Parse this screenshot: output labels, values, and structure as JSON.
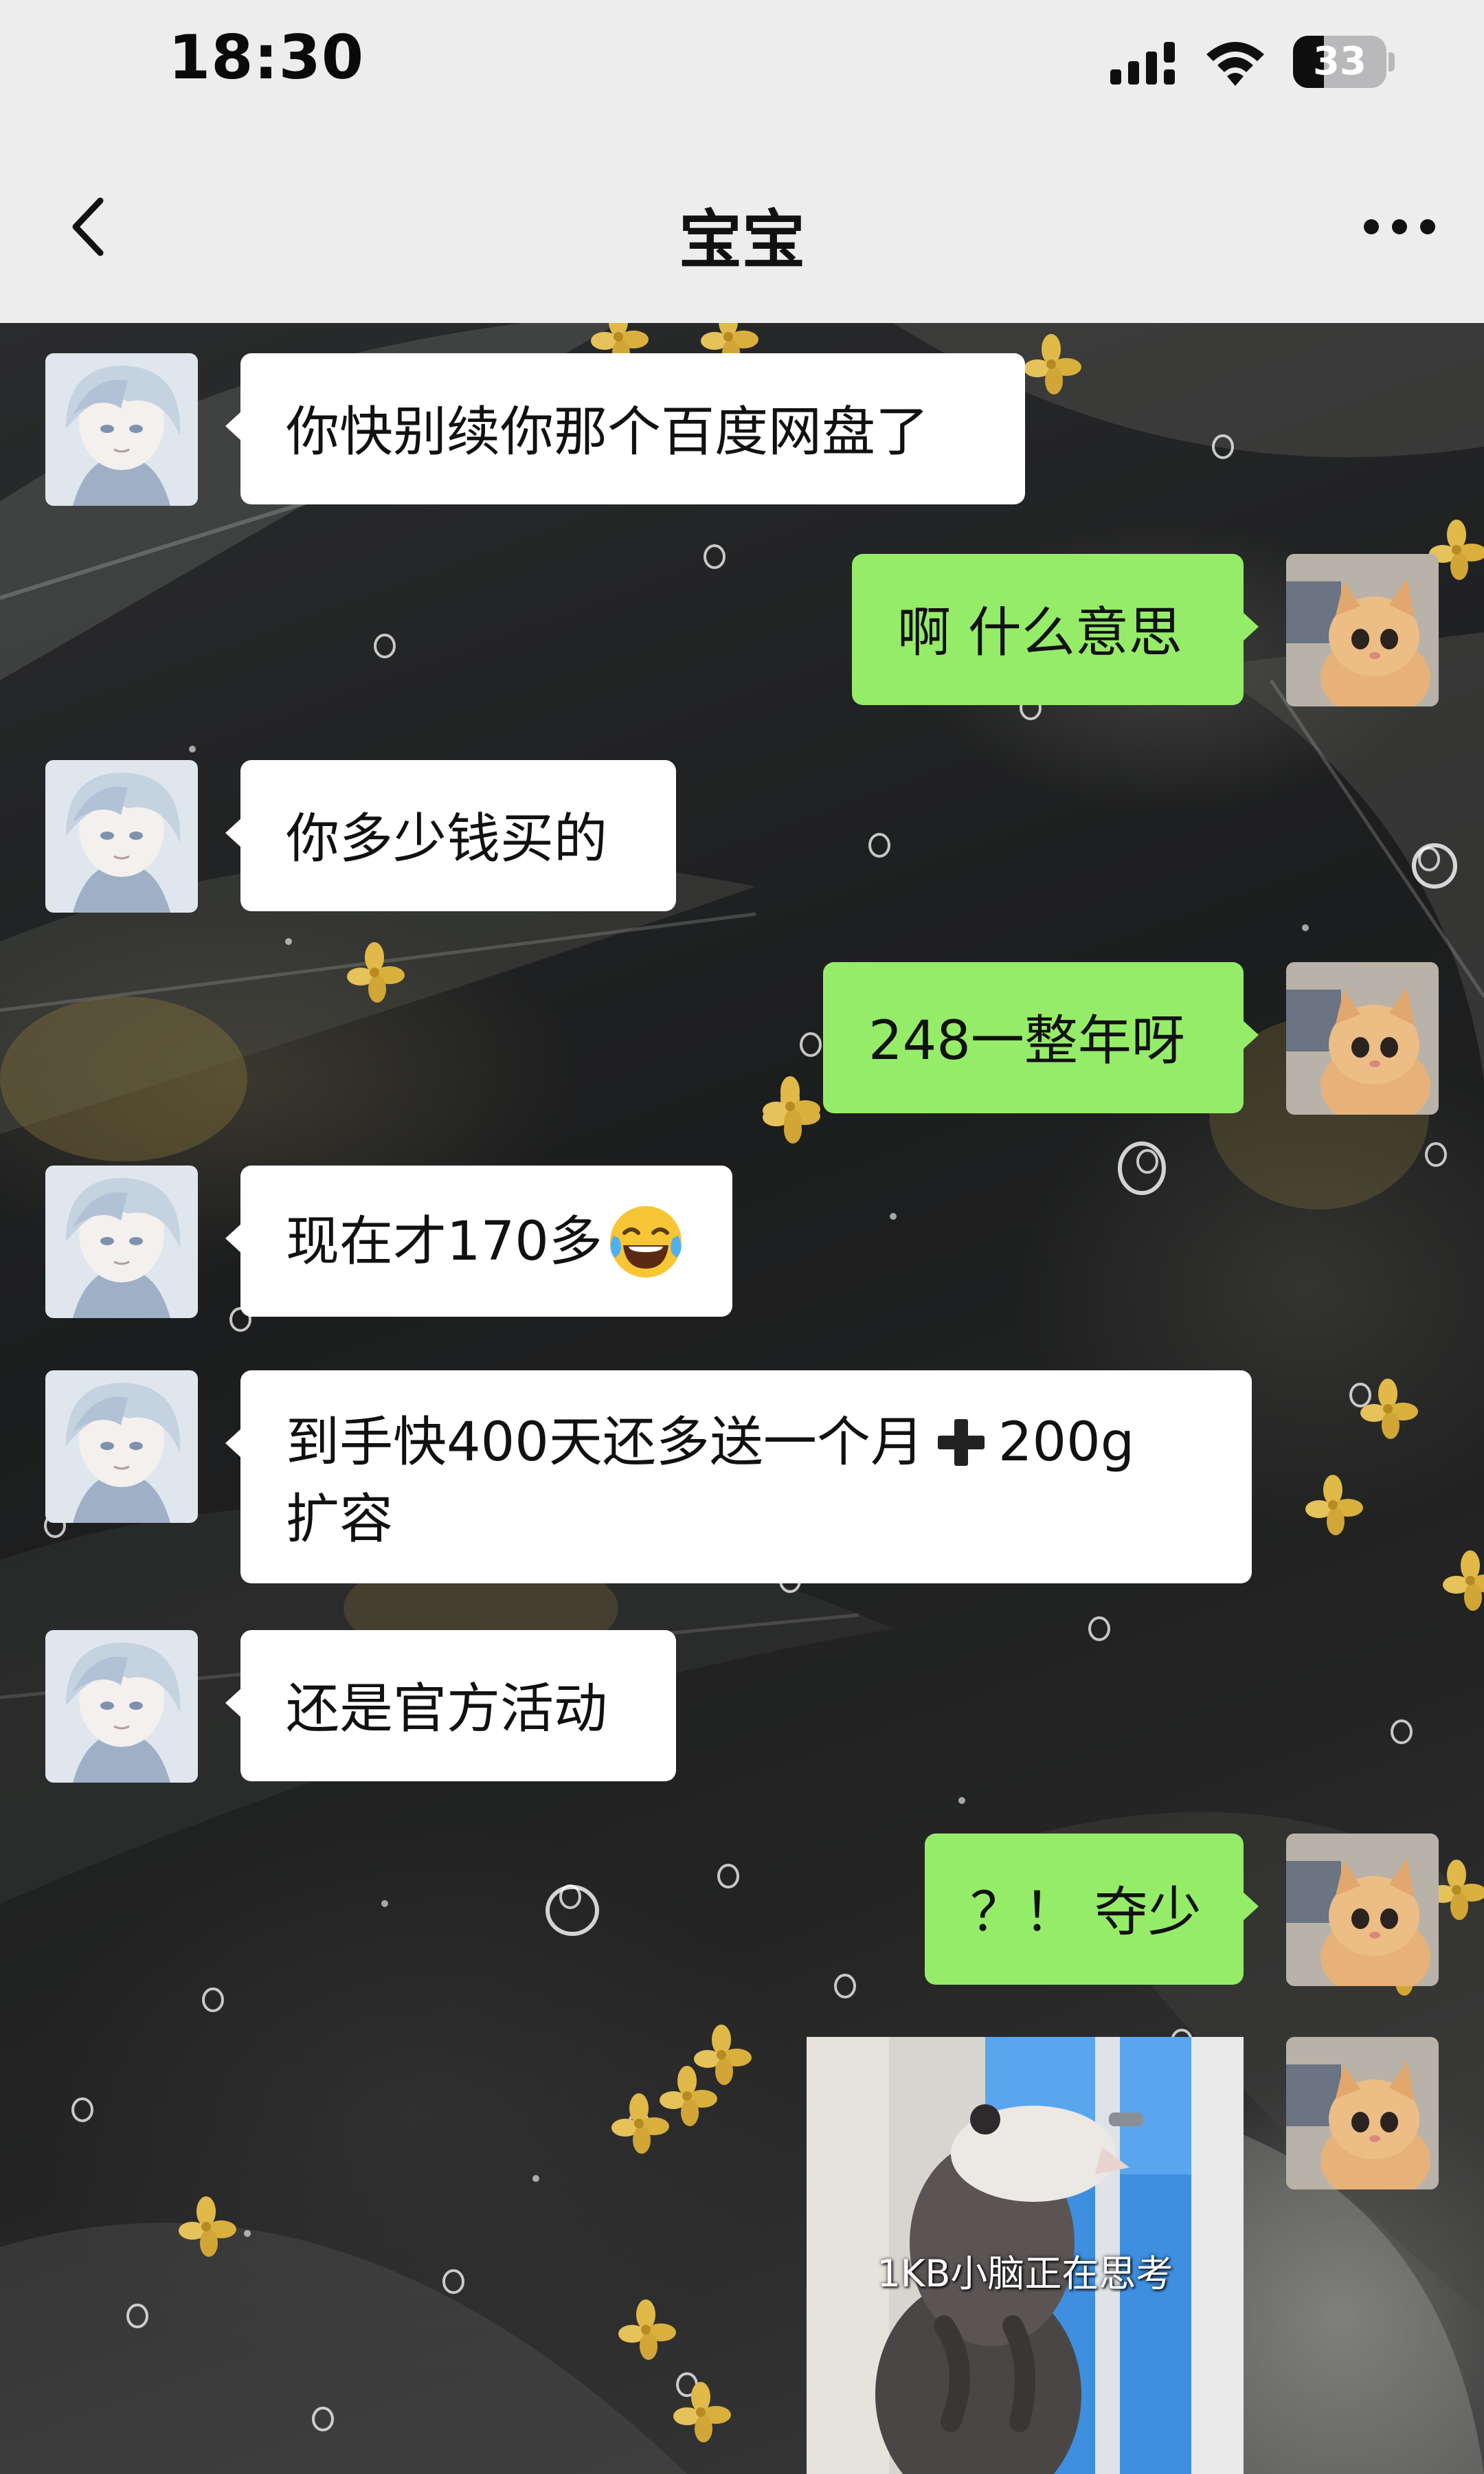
{
  "status_bar": {
    "time": "18:30",
    "battery_level": "33",
    "icons": [
      "signal-icon",
      "wifi-icon",
      "battery-icon"
    ]
  },
  "nav": {
    "title": "宝宝",
    "back_icon": "chevron-left-icon",
    "more_icon": "more-dots-icon"
  },
  "colors": {
    "status_bg": "#ededed",
    "incoming_bubble": "#ffffff",
    "outgoing_bubble": "#95ec69",
    "text": "#111111"
  },
  "messages": [
    {
      "side": "left",
      "text": "你快别续你那个百度网盘了"
    },
    {
      "side": "right",
      "text": "啊 什么意思"
    },
    {
      "side": "left",
      "text": "你多少钱买的"
    },
    {
      "side": "right",
      "text": "248一整年呀"
    },
    {
      "side": "left",
      "text": "现在才170多",
      "emoji": "tears-of-joy-emoji"
    },
    {
      "side": "left",
      "text_line1_before": "到手快400天还多送一个月",
      "plus_icon": "heavy-plus-icon",
      "text_line1_after": "200g",
      "text_line2": "扩容"
    },
    {
      "side": "left",
      "text": "还是官方活动"
    },
    {
      "side": "right",
      "text": "？！ 夺少"
    },
    {
      "side": "right",
      "type": "sticker",
      "caption": "1KB小脑正在思考",
      "sticker_subject": "opossum-at-window"
    }
  ],
  "avatars": {
    "friend": "anime-avatar",
    "self": "kitten-avatar"
  }
}
